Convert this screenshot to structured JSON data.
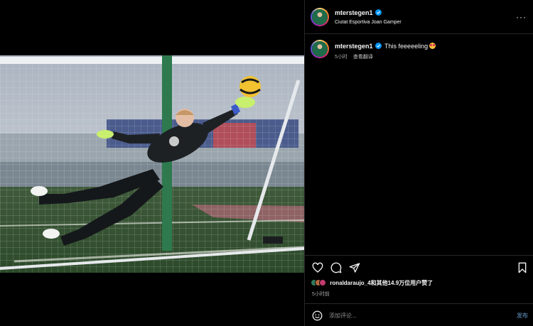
{
  "post": {
    "username": "mterstegen1",
    "location": "Ciutat Esportiva Joan Gamper",
    "more_label": "···"
  },
  "caption": {
    "username": "mterstegen1",
    "text": "This feeeeeling",
    "time": "5小时",
    "translate_label": "查看翻译"
  },
  "likes": {
    "text": "ronaldaraujo_4和其他14.9万位用户赞了",
    "time": "5小时前"
  },
  "comment": {
    "placeholder": "添加评论...",
    "post_label": "发布"
  },
  "colors": {
    "verified": "#0095f6",
    "accent_disabled": "#4a6d8f",
    "background": "#000000"
  },
  "icons": [
    "heart-icon",
    "comment-icon",
    "share-icon",
    "bookmark-icon",
    "smile-icon",
    "verified-icon",
    "more-icon"
  ]
}
